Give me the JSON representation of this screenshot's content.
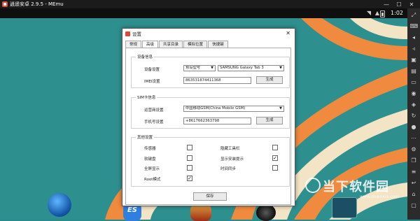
{
  "window": {
    "title": "逍遥安卓 2.9.5 - MEmu"
  },
  "status": {
    "time": "1:02"
  },
  "dialog": {
    "title": "设置",
    "close": "✕",
    "tabs": [
      "常规",
      "高级",
      "共享目录",
      "模拟位置",
      "快捷键"
    ],
    "active_tab": 1,
    "device_info": {
      "title": "设备信息",
      "device_label": "设备设置",
      "device_mode": "预设型号",
      "device_model": "SAMSUNG Galaxy Tab 3",
      "imei_label": "IMEI设置",
      "imei_value": "863531874411368",
      "generate": "生成"
    },
    "sim_info": {
      "title": "SIM卡信息",
      "carrier_label": "运营商设置",
      "carrier_value": "中国移动GSM(China Mobile GSM)",
      "phone_label": "手机号设置",
      "phone_value": "+8617662363798",
      "generate": "生成"
    },
    "other": {
      "title": "其他设置",
      "options": [
        {
          "label": "传感器",
          "checked": false
        },
        {
          "label": "隐藏工具栏",
          "checked": false
        },
        {
          "label": "软键盘",
          "checked": false
        },
        {
          "label": "显示安装提示",
          "checked": true
        },
        {
          "label": "全屏显示",
          "checked": false
        },
        {
          "label": "时间同步",
          "checked": false
        },
        {
          "label": "Root模式",
          "checked": true
        }
      ]
    },
    "save": "保存"
  },
  "watermark": {
    "text": "当下软件园",
    "url": "www.downxia.com"
  }
}
